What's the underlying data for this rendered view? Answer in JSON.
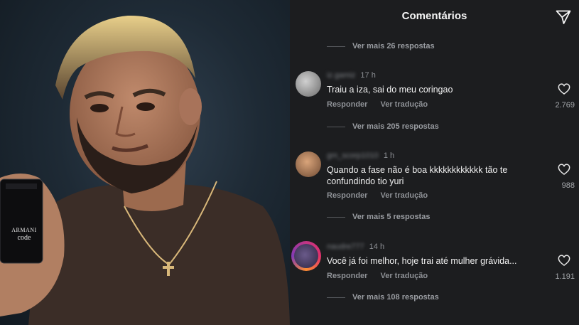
{
  "photo": {
    "product_brand": "ARMANI",
    "product_name": "code"
  },
  "header": {
    "title": "Comentários",
    "share_icon": "send-icon"
  },
  "comments": [
    {
      "replies_above": "Ver mais 26 respostas"
    },
    {
      "username": "iz.gamiz",
      "time": "17 h",
      "text": "Traiu a iza, sai do meu coringao",
      "reply_label": "Responder",
      "translate_label": "Ver tradução",
      "likes": "2.769",
      "more_replies": "Ver mais 205 respostas"
    },
    {
      "username": "gm_scorp1010",
      "time": "1 h",
      "text": "Quando a fase não é boa kkkkkkkkkkkk tão te confundindo tio yuri",
      "reply_label": "Responder",
      "translate_label": "Ver tradução",
      "likes": "988",
      "more_replies": "Ver mais 5 respostas"
    },
    {
      "username": "naudre777",
      "time": "14 h",
      "text": "Você já foi melhor, hoje trai até mulher grávida...",
      "reply_label": "Responder",
      "translate_label": "Ver tradução",
      "likes": "1.191",
      "more_replies": "Ver mais 108 respostas"
    }
  ],
  "colors": {
    "panel_bg": "#1c1d1f",
    "text_primary": "#f0f0f0",
    "text_secondary": "#8e9196"
  }
}
